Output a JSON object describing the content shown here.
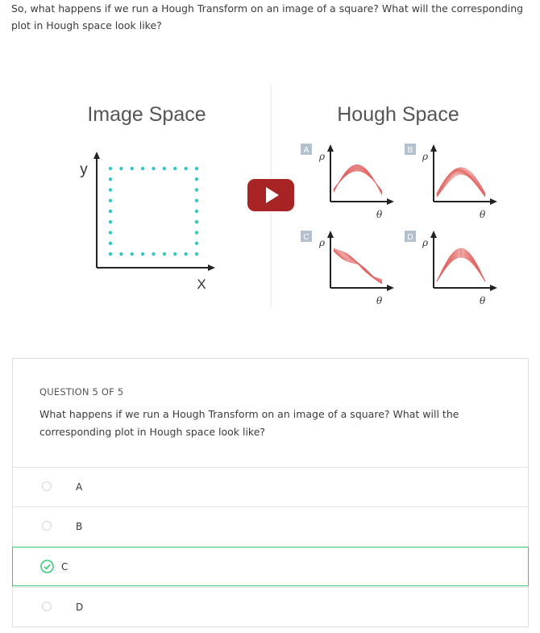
{
  "intro_text": "So, what happens if we run a Hough Transform on an image of a square? What will the corresponding plot in Hough space look like?",
  "figure": {
    "image_space_title": "Image Space",
    "hough_space_title": "Hough Space",
    "axis_y": "y",
    "axis_x": "X",
    "rho": "ρ",
    "theta": "θ",
    "panel_labels": [
      "A",
      "B",
      "C",
      "D"
    ],
    "colors": {
      "dots": "#33c6c4",
      "curves": "#e0625f",
      "play": "#a82424",
      "label_box": "#b3c0cd"
    }
  },
  "question": {
    "number": "QUESTION 5 OF 5",
    "text": "What happens if we run a Hough Transform on an image of a square? What will the corresponding plot in Hough space look like?",
    "options": [
      {
        "label": "A",
        "selected": false
      },
      {
        "label": "B",
        "selected": false
      },
      {
        "label": "C",
        "selected": true
      },
      {
        "label": "D",
        "selected": false
      }
    ]
  }
}
